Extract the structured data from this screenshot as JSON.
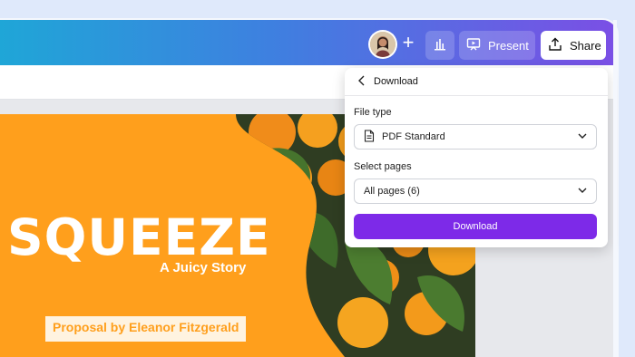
{
  "header": {
    "present_label": "Present",
    "share_label": "Share",
    "plus": "+"
  },
  "download_panel": {
    "title": "Download",
    "file_type_label": "File type",
    "file_type_value": "PDF Standard",
    "select_pages_label": "Select pages",
    "pages_value": "All pages (6)",
    "download_button": "Download"
  },
  "slide": {
    "title": "SQUEEZE",
    "subtitle": "A Juicy Story",
    "proposal": "Proposal by Eleanor Fitzgerald"
  },
  "colors": {
    "accent": "#7d2ae8",
    "slide_orange": "#ff9f1c",
    "topbar_start": "#1fa6d7",
    "topbar_end": "#7b4fe5"
  },
  "icons": {
    "avatar": "user-avatar",
    "insights": "bar-chart-icon",
    "present": "present-icon",
    "share": "upload-share-icon",
    "back": "chevron-left-icon",
    "file": "document-icon",
    "dropdown": "chevron-down-icon"
  }
}
